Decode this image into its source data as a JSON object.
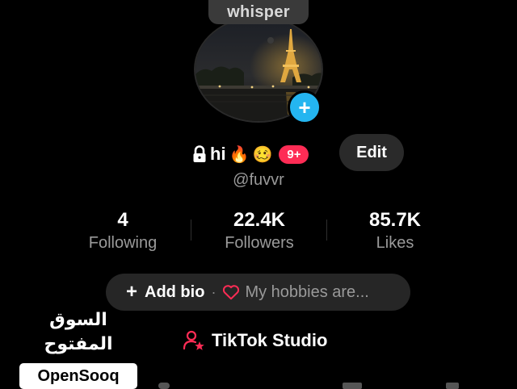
{
  "profile": {
    "note": "whisper",
    "display_name": "hi",
    "emoji_fire": "🔥",
    "emoji_face": "🥴",
    "notification_badge": "9+",
    "edit_label": "Edit",
    "username": "@fuvvr",
    "stats": [
      {
        "value": "4",
        "label": "Following"
      },
      {
        "value": "22.4K",
        "label": "Followers"
      },
      {
        "value": "85.7K",
        "label": "Likes"
      }
    ],
    "bio": {
      "add_label": "Add bio",
      "separator": "·",
      "hobbies_placeholder": "My hobbies are..."
    },
    "studio_label": "TikTok Studio"
  },
  "watermark": {
    "arabic": "السوق المفتوح",
    "latin": "OpenSooq"
  },
  "colors": {
    "accent_blue": "#24b5f0",
    "badge_red": "#fe2c55",
    "background": "#000000"
  }
}
